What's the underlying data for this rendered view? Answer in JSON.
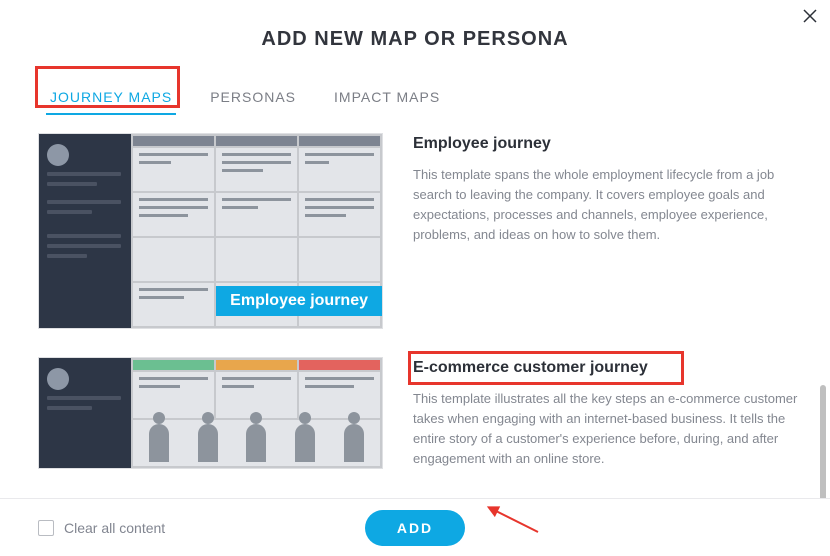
{
  "modal": {
    "title": "ADD NEW MAP OR PERSONA",
    "tabs": {
      "journey": "JOURNEY MAPS",
      "personas": "PERSONAS",
      "impact": "IMPACT MAPS"
    }
  },
  "templates": {
    "employee": {
      "title": "Employee journey",
      "desc": "This template spans the whole employment lifecycle from a job search to leaving the company. It covers employee goals and expectations, processes and channels, employee experience, problems, and ideas on how to solve them.",
      "thumb_label": "Employee journey"
    },
    "ecommerce": {
      "title": "E-commerce customer journey",
      "desc": "This template illustrates all the key steps an e-commerce customer takes when engaging with an internet-based business. It tells the entire story of a customer's experience before, during, and after engagement with an online store."
    }
  },
  "footer": {
    "clear": "Clear all content",
    "add": "ADD"
  }
}
